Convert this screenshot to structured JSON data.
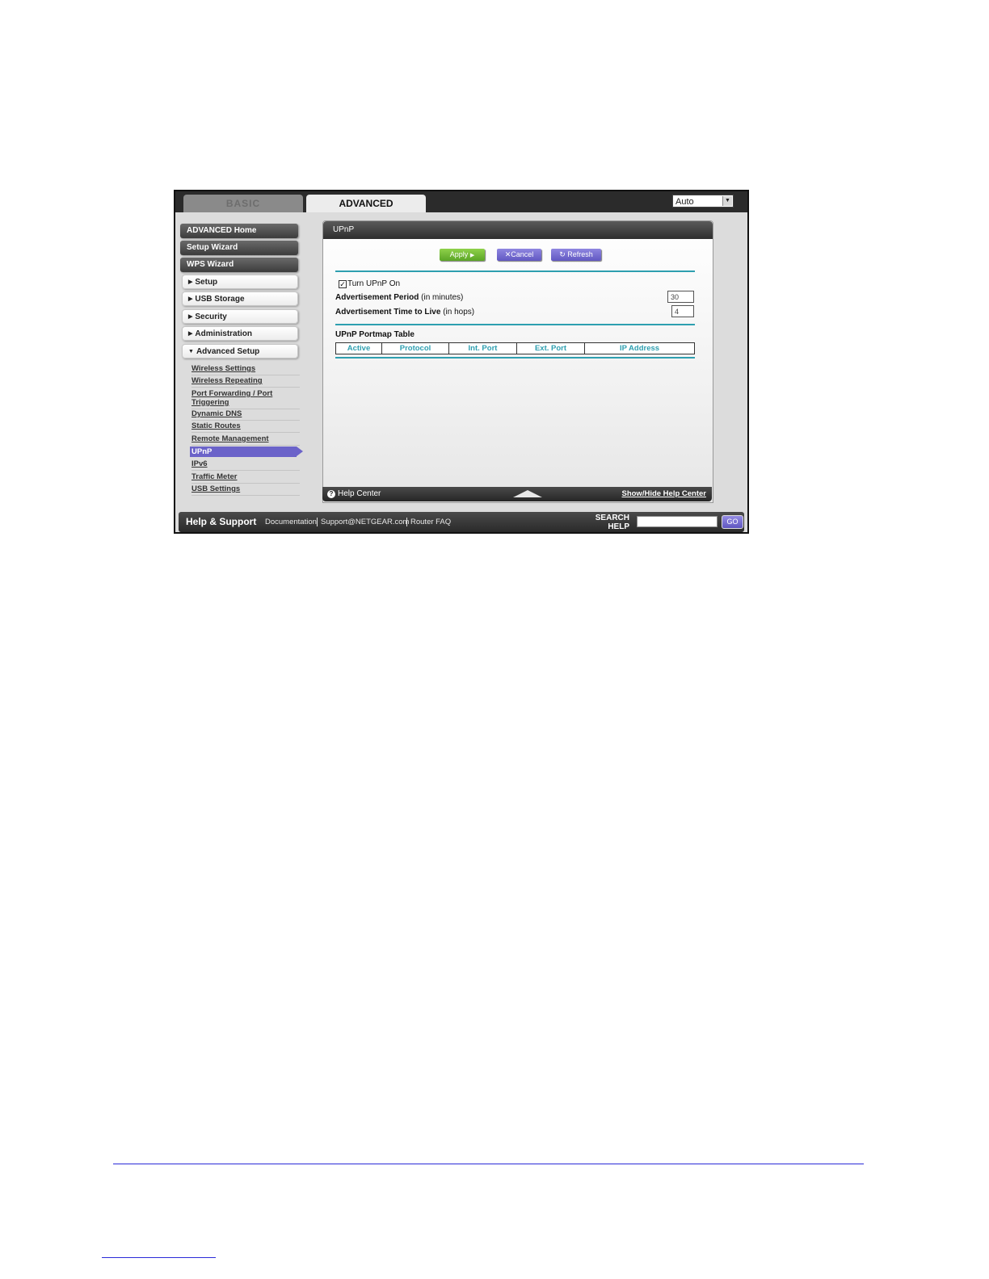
{
  "tabs": {
    "basic": "BASIC",
    "advanced": "ADVANCED"
  },
  "language_select": {
    "value": "Auto"
  },
  "sidebar": {
    "primary": [
      "ADVANCED Home",
      "Setup Wizard",
      "WPS Wizard"
    ],
    "sections": [
      "Setup",
      "USB Storage",
      "Security",
      "Administration",
      "Advanced Setup"
    ],
    "sub_items": [
      "Wireless Settings",
      "Wireless Repeating",
      "Port Forwarding / Port",
      "Triggering",
      "Dynamic DNS",
      "Static Routes",
      "Remote Management",
      "UPnP",
      "IPv6",
      "Traffic Meter",
      "USB Settings"
    ]
  },
  "panel": {
    "title": "UPnP",
    "apply_label": "Apply",
    "cancel_label": "Cancel",
    "refresh_label": "Refresh",
    "turn_on_label": "Turn UPnP On",
    "turn_on_checked": true,
    "adv_period_bold": "Advertisement Period",
    "adv_period_rest": " (in minutes)",
    "adv_period_value": "30",
    "adv_ttl_bold": "Advertisement Time to Live",
    "adv_ttl_rest": " (in hops)",
    "adv_ttl_value": "4",
    "portmap_title": "UPnP Portmap Table",
    "columns": [
      "Active",
      "Protocol",
      "Int. Port",
      "Ext. Port",
      "IP Address"
    ]
  },
  "help_bar": {
    "label": "Help Center",
    "toggle": "Show/Hide Help Center"
  },
  "support": {
    "title": "Help & Support",
    "links": [
      "Documentation",
      "Support@NETGEAR.com",
      "Router FAQ"
    ],
    "search_label_1": "SEARCH",
    "search_label_2": "HELP",
    "go_label": "GO"
  },
  "colors": {
    "accent_purple": "#6b63c9",
    "accent_green": "#5ba526",
    "teal": "#2e9fb0",
    "footer_rule": "#2a2ad8"
  }
}
